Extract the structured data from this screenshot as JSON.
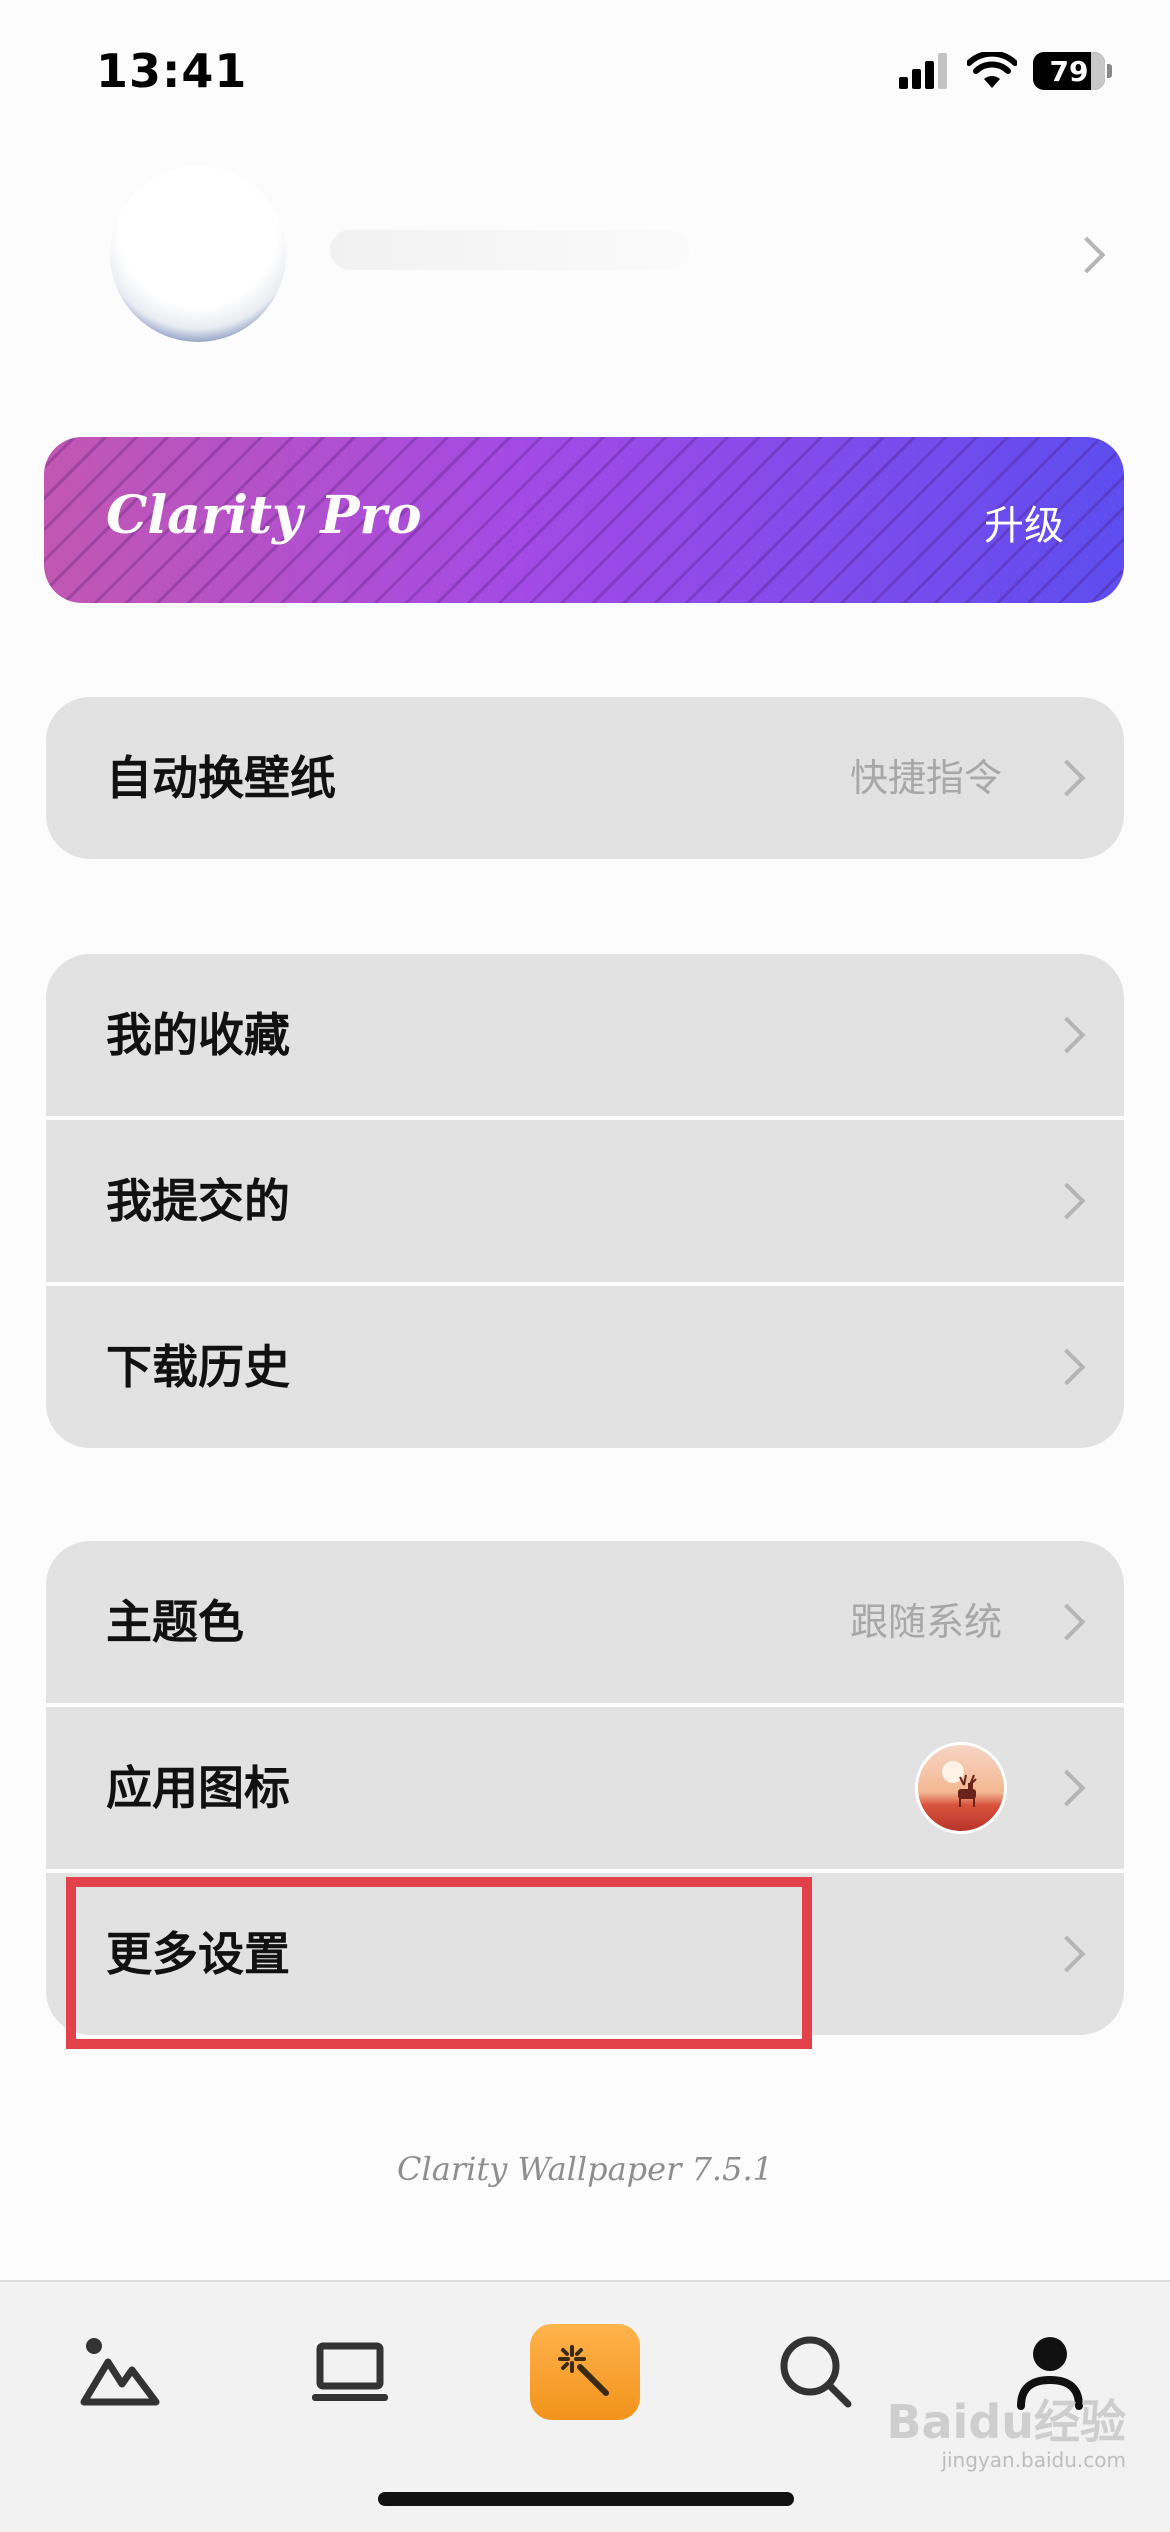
{
  "status_bar": {
    "time": "13:41",
    "battery": "79",
    "icons": [
      "signal-icon",
      "wifi-icon",
      "battery-icon"
    ]
  },
  "profile": {
    "name": ""
  },
  "pro_banner": {
    "title": "Clarity Pro",
    "action": "升级",
    "colors": [
      "#c257b2",
      "#a34ae6",
      "#5d4df0"
    ]
  },
  "group1": {
    "items": [
      {
        "label": "自动换壁纸",
        "value": "快捷指令"
      }
    ]
  },
  "group2": {
    "items": [
      {
        "label": "我的收藏"
      },
      {
        "label": "我提交的"
      },
      {
        "label": "下载历史"
      }
    ]
  },
  "group3": {
    "items": [
      {
        "label": "主题色",
        "value": "跟随系统"
      },
      {
        "label": "应用图标"
      },
      {
        "label": "更多设置"
      }
    ]
  },
  "version": "Clarity Wallpaper 7.5.1",
  "tab_bar": {
    "tabs": [
      "gallery-tab",
      "desktop-tab",
      "magic-tab",
      "search-tab",
      "profile-tab"
    ],
    "active_accent": "#f2931b"
  },
  "highlight_color": "#e2414a",
  "watermark": {
    "brand": "Baidu经验",
    "url": "jingyan.baidu.com"
  }
}
